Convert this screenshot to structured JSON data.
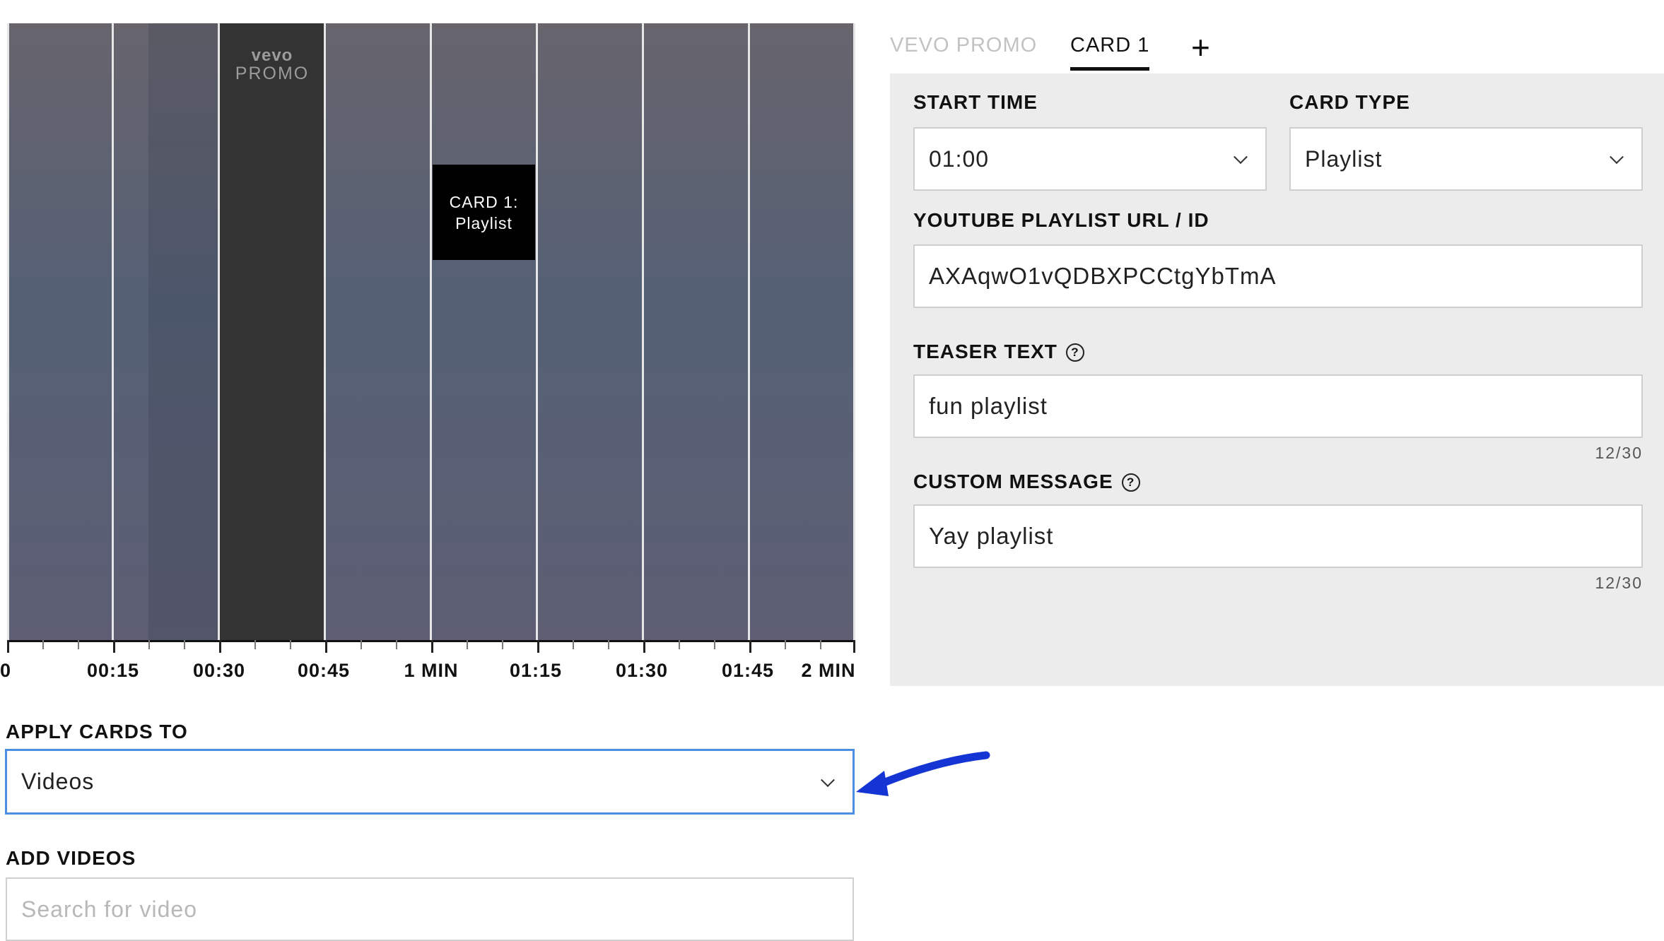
{
  "timeline": {
    "promo_brand": "vevo",
    "promo_word": "PROMO",
    "card_marker": {
      "line1": "CARD 1:",
      "line2": "Playlist"
    },
    "tick_labels": [
      "0",
      "00:15",
      "00:30",
      "00:45",
      "1 MIN",
      "01:15",
      "01:30",
      "01:45",
      "2 MIN"
    ]
  },
  "apply_cards": {
    "label": "APPLY CARDS TO",
    "value": "Videos"
  },
  "add_videos": {
    "label": "ADD VIDEOS",
    "placeholder": "Search for video"
  },
  "tabs": [
    {
      "label": "VEVO PROMO",
      "active": false
    },
    {
      "label": "CARD 1",
      "active": true
    }
  ],
  "add_tab_symbol": "+",
  "card_form": {
    "start_time": {
      "label": "START TIME",
      "value": "01:00"
    },
    "card_type": {
      "label": "CARD TYPE",
      "value": "Playlist"
    },
    "playlist_url": {
      "label": "YOUTUBE PLAYLIST URL / ID",
      "value": "AXAqwO1vQDBXPCCtgYbTmA"
    },
    "teaser_text": {
      "label": "TEASER TEXT",
      "value": "fun playlist",
      "counter": "12/30"
    },
    "custom_message": {
      "label": "CUSTOM MESSAGE",
      "value": "Yay playlist",
      "counter": "12/30"
    },
    "help_symbol": "?"
  },
  "colors": {
    "focus_border": "#4a90e2",
    "annotation_arrow": "#1435d4",
    "panel_bg": "#ececec",
    "promo_block": "#333333",
    "card_marker": "#000000"
  }
}
